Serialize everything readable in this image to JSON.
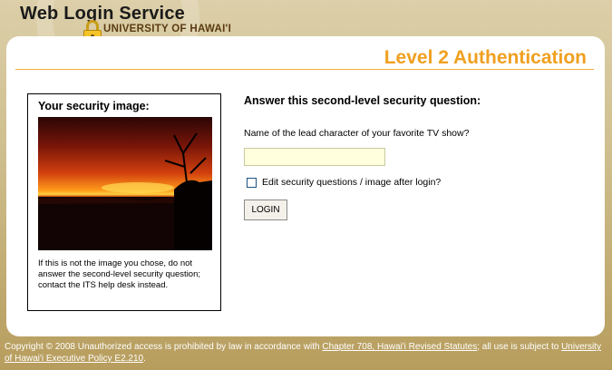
{
  "header": {
    "title": "Web Login Service",
    "subtitle": "UNIVERSITY OF HAWAI'I"
  },
  "panel": {
    "level_title": "Level 2 Authentication"
  },
  "security_box": {
    "title": "Your security image:",
    "note": "If this is not the image you chose, do not answer the second-level security question; contact the ITS help desk instead."
  },
  "question": {
    "title": "Answer this second-level security question:",
    "label": "Name of the lead character of your favorite TV show?",
    "answer_value": "",
    "checkbox_label": "Edit security questions / image after login?",
    "checkbox_checked": false,
    "login_label": "LOGIN"
  },
  "footer": {
    "text1": "Copyright © 2008 Unauthorized access is prohibited by law in accordance with ",
    "link1": "Chapter 708, Hawai'i Revised Statutes",
    "text2": "; all use is subject to ",
    "link2": "University of Hawai'i Executive Policy E2.210",
    "text3": "."
  },
  "colors": {
    "accent": "#f0a020",
    "background": "#cfbf8f",
    "answer_field": "#ffffdd"
  }
}
